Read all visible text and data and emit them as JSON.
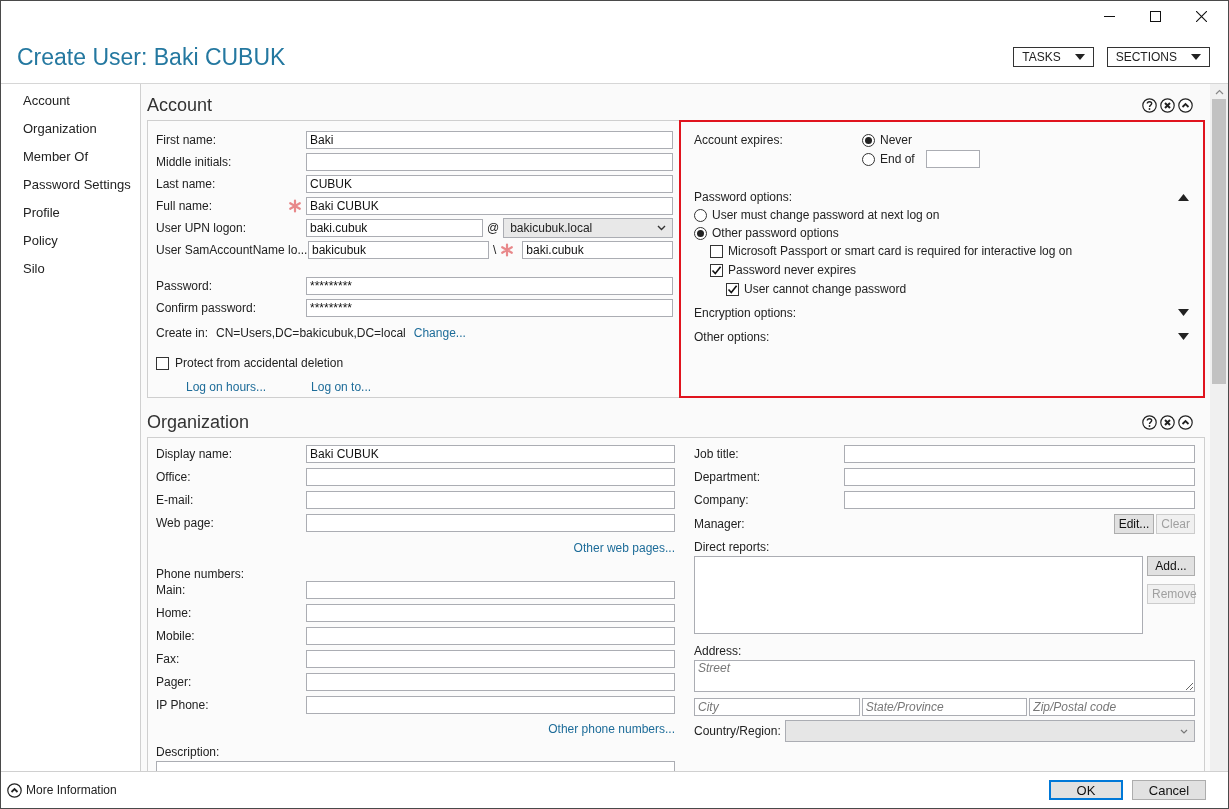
{
  "window": {
    "title": "Create User: Baki CUBUK"
  },
  "header_buttons": [
    "TASKS",
    "SECTIONS"
  ],
  "nav": {
    "items": [
      "Account",
      "Organization",
      "Member Of",
      "Password Settings",
      "Profile",
      "Policy",
      "Silo"
    ]
  },
  "account": {
    "heading": "Account",
    "fields": [
      {
        "kind": "text",
        "label": "First name:",
        "value": "Baki",
        "required": false
      },
      {
        "kind": "text",
        "label": "Middle initials:",
        "required": false
      },
      {
        "kind": "text",
        "label": "Last name:",
        "value": "CUBUK",
        "required": false
      },
      {
        "kind": "text",
        "label": "Full name:",
        "value": "Baki CUBUK",
        "required": true
      },
      {
        "kind": "upn",
        "label": "User UPN logon:",
        "value": "baki.cubuk",
        "separator": "@",
        "domain": "bakicubuk.local",
        "required": false
      },
      {
        "kind": "sam",
        "label": "User SamAccountName lo...",
        "value": "bakicubuk",
        "separator": "\\",
        "value2": "baki.cubuk",
        "required": true
      }
    ],
    "password_fields": [
      {
        "label": "Password:",
        "value": "*********"
      },
      {
        "label": "Confirm password:",
        "value": "*********"
      }
    ],
    "create_in": {
      "label": "Create in:",
      "value": "CN=Users,DC=bakicubuk,DC=local",
      "link": "Change..."
    },
    "protect": {
      "label": "Protect from accidental deletion",
      "checked": false
    },
    "links": [
      "Log on hours...",
      "Log on to..."
    ],
    "expires": {
      "label": "Account expires:",
      "options": [
        {
          "kind": "plain",
          "label": "Never",
          "selected": true
        },
        {
          "kind": "date",
          "label": "End of",
          "selected": false
        }
      ]
    },
    "password_options": {
      "label": "Password options:",
      "expanded": true,
      "options": [
        {
          "label": "User must change password at next log on",
          "selected": false
        },
        {
          "label": "Other password options",
          "selected": true
        }
      ],
      "checks": [
        {
          "label": "Microsoft Passport or smart card is required for interactive log on",
          "checked": false
        },
        {
          "label": "Password never expires",
          "checked": true,
          "children": [
            {
              "label": "User cannot change password",
              "checked": true
            }
          ]
        }
      ]
    },
    "more_options": [
      {
        "label": "Encryption options:",
        "expanded": false
      },
      {
        "label": "Other options:",
        "expanded": false
      }
    ]
  },
  "organization": {
    "heading": "Organization",
    "left_fields": [
      {
        "label": "Display name:",
        "value": "Baki CUBUK"
      },
      {
        "label": "Office:"
      },
      {
        "label": "E-mail:"
      },
      {
        "label": "Web page:"
      }
    ],
    "web_link": "Other web pages...",
    "phone_heading": "Phone numbers:",
    "phone_fields": [
      {
        "label": "Main:"
      },
      {
        "label": "Home:"
      },
      {
        "label": "Mobile:"
      },
      {
        "label": "Fax:"
      },
      {
        "label": "Pager:"
      },
      {
        "label": "IP Phone:"
      }
    ],
    "phone_link": "Other phone numbers...",
    "description_label": "Description:",
    "right_fields": [
      {
        "label": "Job title:"
      },
      {
        "label": "Department:"
      },
      {
        "label": "Company:"
      }
    ],
    "manager": {
      "label": "Manager:",
      "buttons": [
        {
          "label": "Edit...",
          "disabled": false
        },
        {
          "label": "Clear",
          "disabled": true
        }
      ]
    },
    "direct_reports": {
      "label": "Direct reports:",
      "buttons": [
        {
          "label": "Add...",
          "disabled": false
        },
        {
          "label": "Remove",
          "disabled": true
        }
      ]
    },
    "address": {
      "label": "Address:",
      "street_placeholder": "Street",
      "placeholders": [
        "City",
        "State/Province",
        "Zip/Postal code"
      ]
    },
    "country": {
      "label": "Country/Region:",
      "disabled": true
    }
  },
  "footer": {
    "more_info": "More Information",
    "buttons": [
      {
        "label": "OK",
        "default": true
      },
      {
        "label": "Cancel",
        "default": false
      }
    ]
  }
}
